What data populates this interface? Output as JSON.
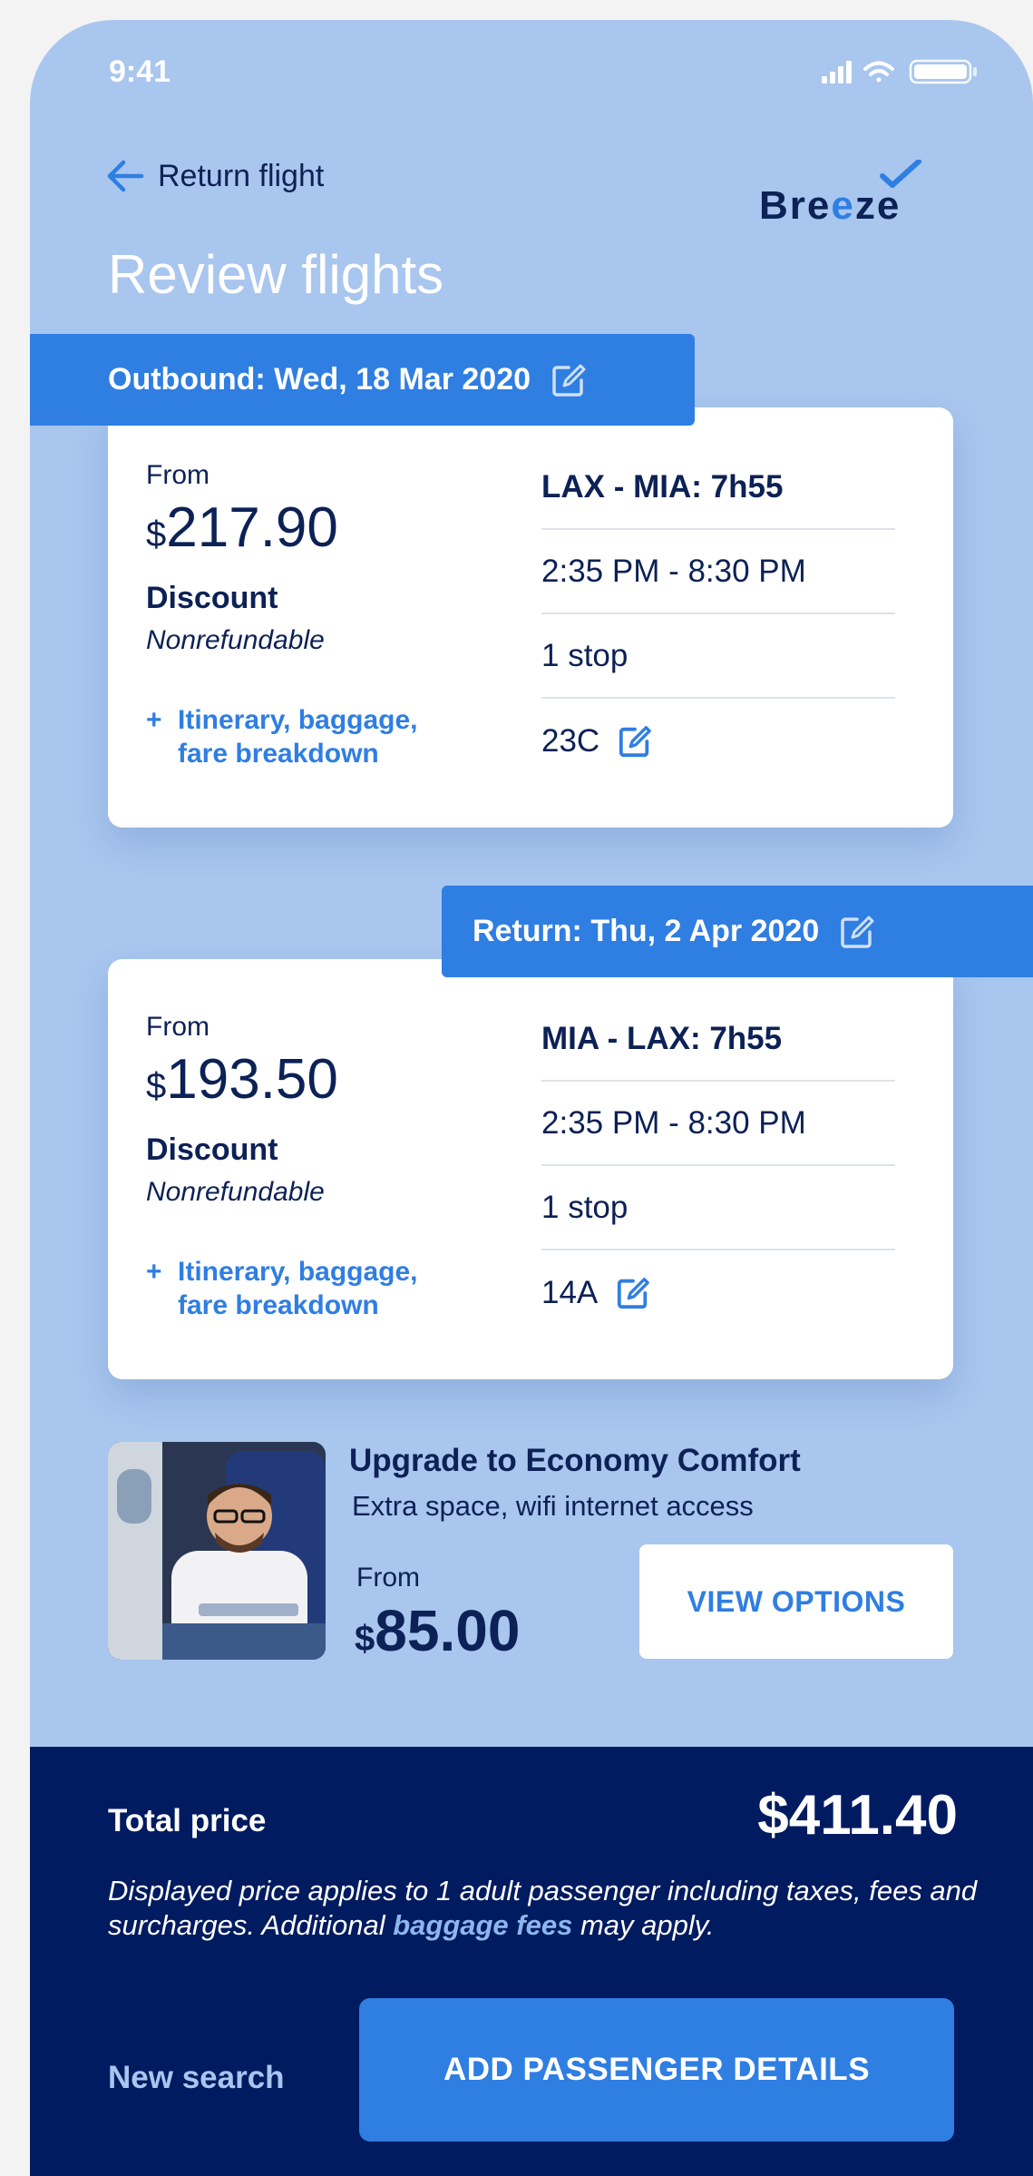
{
  "status_bar": {
    "time": "9:41"
  },
  "header": {
    "back_label": "Return flight",
    "logo_text": "Breeze",
    "page_title": "Review flights"
  },
  "outbound": {
    "tab_label": "Outbound: Wed, 18 Mar 2020",
    "from_label": "From",
    "currency": "$",
    "price": "217.90",
    "fare_type": "Discount",
    "refund_policy": "Nonrefundable",
    "details_plus": "+",
    "details_line1": "Itinerary, baggage,",
    "details_line2": "fare breakdown",
    "route": "LAX - MIA: 7h55",
    "times": "2:35 PM - 8:30 PM",
    "stops": "1 stop",
    "seat": "23C"
  },
  "return": {
    "tab_label": "Return: Thu, 2 Apr 2020",
    "from_label": "From",
    "currency": "$",
    "price": "193.50",
    "fare_type": "Discount",
    "refund_policy": "Nonrefundable",
    "details_plus": "+",
    "details_line1": "Itinerary, baggage,",
    "details_line2": "fare breakdown",
    "route": "MIA - LAX: 7h55",
    "times": "2:35 PM - 8:30 PM",
    "stops": "1 stop",
    "seat": "14A"
  },
  "upgrade": {
    "title": "Upgrade to Economy Comfort",
    "subtitle": "Extra space, wifi internet access",
    "from_label": "From",
    "currency": "$",
    "price": "85.00",
    "button_label": "VIEW OPTIONS"
  },
  "footer": {
    "total_label": "Total price",
    "total_value": "$411.40",
    "disclaimer_part1": "Displayed price applies to 1 adult passenger including taxes, fees and surcharges. Additional ",
    "disclaimer_link": "baggage fees",
    "disclaimer_part2": " may apply.",
    "new_search_label": "New search",
    "primary_button_label": "ADD PASSENGER DETAILS"
  },
  "colors": {
    "background": "#a8c6ee",
    "accent": "#2f7ee2",
    "navy": "#0c2155",
    "footer": "#011b60"
  }
}
